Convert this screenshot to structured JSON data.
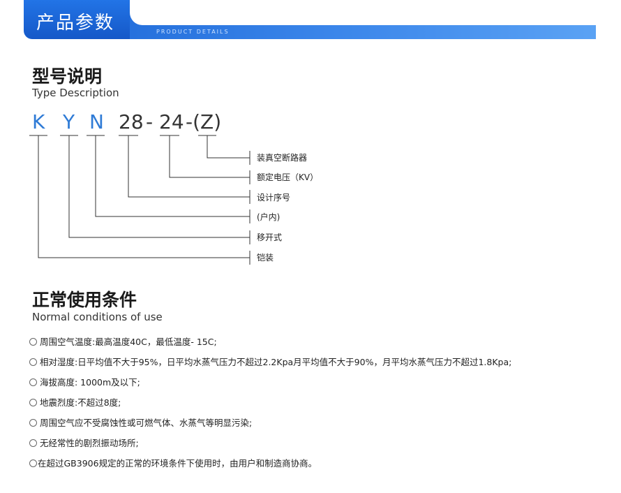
{
  "header": {
    "title": "产品参数",
    "subtitle": "PRODUCT DETAILS"
  },
  "type_section": {
    "title": "型号说明",
    "subtitle": "Type Description",
    "code": [
      "K",
      "Y",
      "N",
      "28",
      "-",
      "24",
      "-(Z)"
    ],
    "descriptions": [
      "装真空断路器",
      "额定电压（KV）",
      "设计序号",
      "(户内)",
      "移开式",
      "铠装"
    ]
  },
  "conditions_section": {
    "title": "正常使用条件",
    "subtitle": "Normal conditions of use",
    "items": [
      "周围空气温度:最高温度40C，最低温度- 15C;",
      "相对湿度:日平均值不大于95%，日平均水蒸气压力不超过2.2Kpa月平均值不大于90%，月平均水蒸气压力不超过1.8Kpa;",
      "海拔高度: 1000m及以下;",
      "地震烈度:不超过8度;",
      "周围空气应不受腐蚀性或可燃气体、水蒸气等明显污染;",
      "无经常性的剧烈振动场所;",
      "在超过GB3906规定的正常的环境条件下使用时，由用户和制造商协商。"
    ]
  },
  "colors": {
    "accent_blue": "#2f7bd6",
    "banner_blue": "#1b66d6"
  }
}
